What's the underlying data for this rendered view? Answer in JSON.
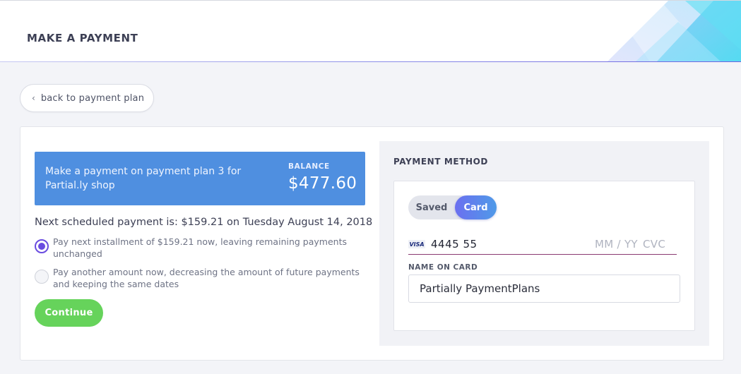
{
  "header": {
    "title": "MAKE A PAYMENT",
    "accent_colors": [
      "#b9c4f7",
      "#7fc7f7",
      "#3fd4f2"
    ]
  },
  "nav": {
    "back_label": "back to payment plan",
    "back_icon": "chevron-left-icon"
  },
  "banner": {
    "message": "Make a payment on payment plan 3 for Partial.ly shop",
    "balance_label": "BALANCE",
    "balance_value": "$477.60",
    "color": "#4f8fe0"
  },
  "schedule": {
    "next_text": "Next scheduled payment is: $159.21 on Tuesday August 14, 2018"
  },
  "options": [
    {
      "label": "Pay next installment of $159.21 now, leaving remaining payments unchanged",
      "selected": true
    },
    {
      "label": "Pay another amount now, decreasing the amount of future payments and keeping the same dates",
      "selected": false
    }
  ],
  "actions": {
    "continue_label": "Continue",
    "continue_color": "#66d35b"
  },
  "payment_method": {
    "title": "PAYMENT METHOD",
    "tabs": [
      {
        "label": "Saved",
        "active": false
      },
      {
        "label": "Card",
        "active": true
      }
    ],
    "card": {
      "brand": "VISA",
      "number": "4445 55",
      "expiry_placeholder": "MM / YY",
      "cvc_placeholder": "CVC"
    },
    "name_label": "NAME ON CARD",
    "name_value": "Partially PaymentPlans"
  }
}
